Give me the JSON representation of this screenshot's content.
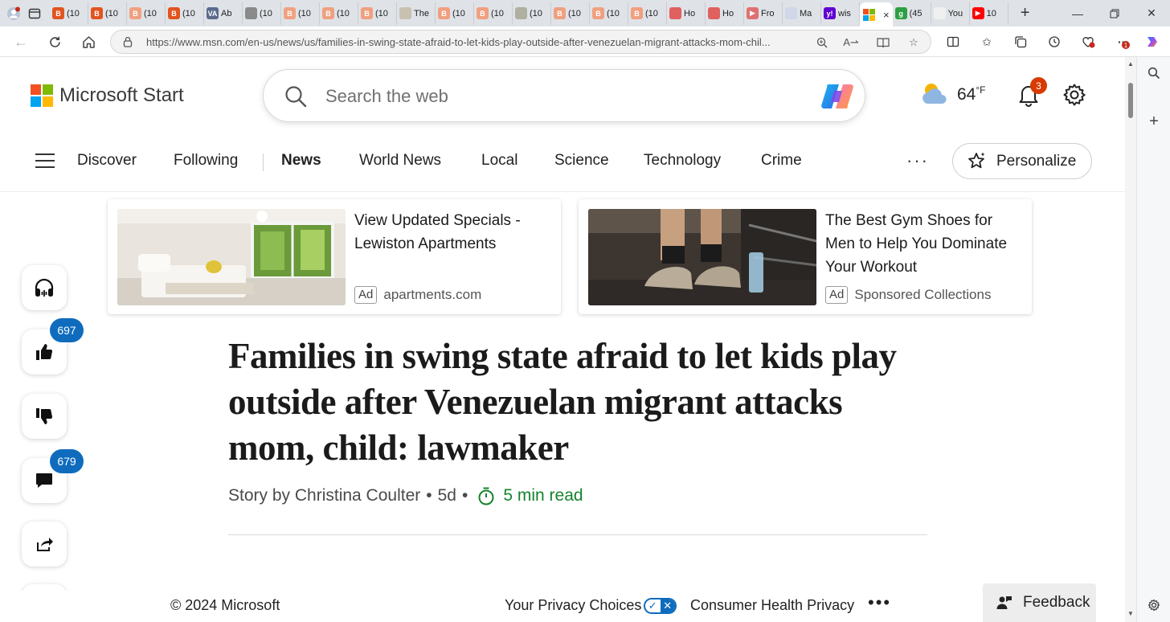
{
  "browser": {
    "tabs": [
      {
        "label": "(10",
        "fav_color": "#e2541f",
        "fav": "B"
      },
      {
        "label": "(10",
        "fav_color": "#e2541f",
        "fav": "B"
      },
      {
        "label": "(10",
        "fav_color": "#f0a080",
        "fav": "B"
      },
      {
        "label": "(10",
        "fav_color": "#e2541f",
        "fav": "B"
      },
      {
        "label": "Ab",
        "fav_color": "#5a6b8c",
        "fav": "VA"
      },
      {
        "label": "(10",
        "fav_color": "#8a8a8a",
        "fav": ""
      },
      {
        "label": "(10",
        "fav_color": "#f0a080",
        "fav": "B"
      },
      {
        "label": "(10",
        "fav_color": "#f0a080",
        "fav": "B"
      },
      {
        "label": "(10",
        "fav_color": "#f0a080",
        "fav": "B"
      },
      {
        "label": "The",
        "fav_color": "#c8c0b0",
        "fav": ""
      },
      {
        "label": "(10",
        "fav_color": "#f0a080",
        "fav": "B"
      },
      {
        "label": "(10",
        "fav_color": "#f0a080",
        "fav": "B"
      },
      {
        "label": "(10",
        "fav_color": "#b0b0a0",
        "fav": ""
      },
      {
        "label": "(10",
        "fav_color": "#f0a080",
        "fav": "B"
      },
      {
        "label": "(10",
        "fav_color": "#f0a080",
        "fav": "B"
      },
      {
        "label": "(10",
        "fav_color": "#f0a080",
        "fav": "B"
      },
      {
        "label": "Ho",
        "fav_color": "#e06060",
        "fav": ""
      },
      {
        "label": "Ho",
        "fav_color": "#e06060",
        "fav": ""
      },
      {
        "label": "Fro",
        "fav_color": "#e07070",
        "fav": "▶"
      },
      {
        "label": "Ma",
        "fav_color": "#d0d8e8",
        "fav": ""
      },
      {
        "label": "wis",
        "fav_color": "#6001d2",
        "fav": "y!"
      }
    ],
    "active_tab": {
      "label": "",
      "close": "×"
    },
    "tabs_after": [
      {
        "label": "(45",
        "fav_color": "#2ea043",
        "fav": "g"
      },
      {
        "label": "You",
        "fav_color": "#f0f0f0",
        "fav": ""
      },
      {
        "label": "10",
        "fav_color": "#ff0000",
        "fav": "▶"
      }
    ],
    "new_tab": "+",
    "url": "https://www.msn.com/en-us/news/us/families-in-swing-state-afraid-to-let-kids-play-outside-after-venezuelan-migrant-attacks-mom-chil...",
    "url_host": "www.msn.com",
    "extension_badge": "1"
  },
  "header": {
    "logo_text": "Microsoft Start",
    "search_placeholder": "Search the web",
    "temperature": "64",
    "temp_unit": "°F",
    "notifications": "3"
  },
  "nav": {
    "items": [
      "Discover",
      "Following",
      "News",
      "World News",
      "Local",
      "Science",
      "Technology",
      "Crime"
    ],
    "active": "News",
    "more": "···",
    "personalize": "Personalize"
  },
  "ads": [
    {
      "title": "View Updated Specials - Lewiston Apartments",
      "badge": "Ad",
      "source": "apartments.com"
    },
    {
      "title": "The Best Gym Shoes for Men to Help You Dominate Your Workout",
      "badge": "Ad",
      "source": "Sponsored Collections"
    }
  ],
  "actions": {
    "likes": "697",
    "comments": "679"
  },
  "article": {
    "headline": "Families in swing state afraid to let kids play outside after Venezuelan migrant attacks mom, child: lawmaker",
    "byline": "Story by Christina Coulter",
    "age": "5d",
    "sep": "•",
    "read_time": "5 min read"
  },
  "footer": {
    "copyright": "© 2024 Microsoft",
    "privacy": "Your Privacy Choices",
    "health": "Consumer Health Privacy",
    "more": "•••",
    "feedback": "Feedback"
  },
  "colors": {
    "accent": "#0f6cbd",
    "read_time": "#16832c",
    "badge_red": "#d83b01"
  }
}
